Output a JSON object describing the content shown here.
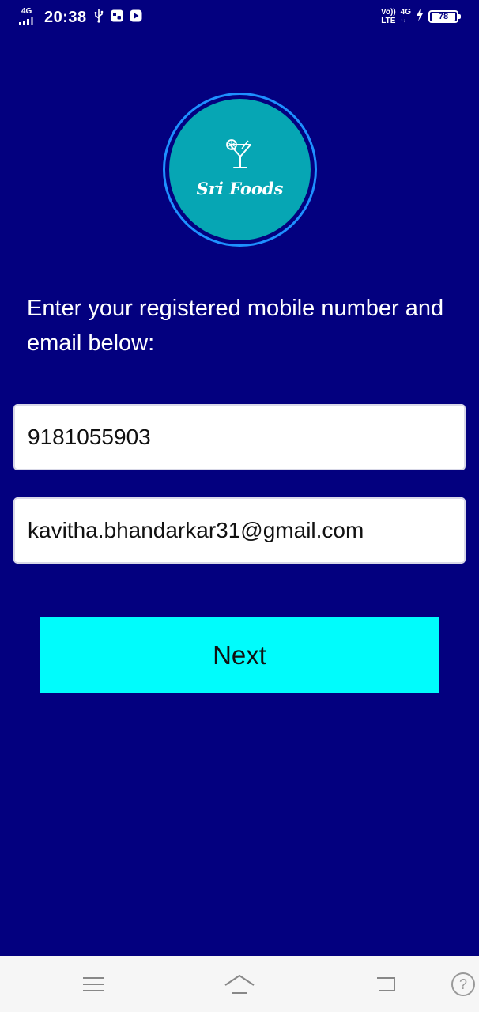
{
  "status_bar": {
    "network": "4G",
    "time": "20:38",
    "volte_top": "Vo))",
    "volte_bottom": "LTE",
    "lte": "4G",
    "battery": "78"
  },
  "logo": {
    "name": "Sri Foods",
    "icon": "cocktail-glass-icon"
  },
  "form": {
    "instruction": "Enter your registered mobile number and email below:",
    "mobile_value": "9181055903",
    "email_value": "kavitha.bhandarkar31@gmail.com",
    "next_label": "Next"
  },
  "nav_bar": {
    "icons": [
      "menu-icon",
      "home-icon",
      "back-icon",
      "help-icon"
    ],
    "help_symbol": "?"
  },
  "colors": {
    "background": "#03007f",
    "logo_fill": "#06a6b4",
    "button": "#00fcfc"
  }
}
